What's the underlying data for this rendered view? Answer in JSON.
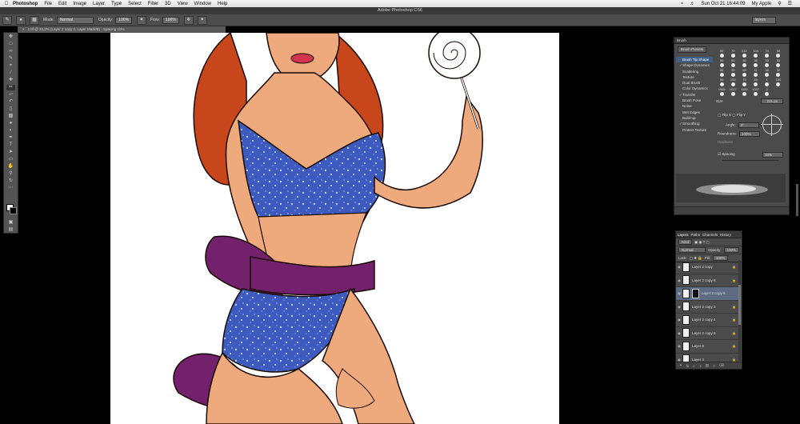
{
  "menubar": {
    "app": "Photoshop",
    "items": [
      "File",
      "Edit",
      "Image",
      "Layer",
      "Type",
      "Select",
      "Filter",
      "3D",
      "View",
      "Window",
      "Help"
    ],
    "clock": "Sun Oct 21  16:44:09",
    "user": "My Apple"
  },
  "window_title": "Adobe Photoshop CS6",
  "options": {
    "mode_label": "Mode:",
    "mode_value": "Normal",
    "opacity_label": "Opacity:",
    "opacity_value": "100%",
    "flow_label": "Flow:",
    "flow_value": "100%",
    "workspace": "layers"
  },
  "doc_tab": "1.tif @ 33.3% (Layer 2 copy 2, Layer Mask/8) - Spacing 10%",
  "brush_panel": {
    "title": "Brush",
    "presets_button": "Brush Presets",
    "settings": [
      {
        "label": "Brush Tip Shape",
        "checked": false,
        "active": true
      },
      {
        "label": "Shape Dynamics",
        "checked": true,
        "active": false
      },
      {
        "label": "Scattering",
        "checked": false,
        "active": false
      },
      {
        "label": "Texture",
        "checked": false,
        "active": false
      },
      {
        "label": "Dual Brush",
        "checked": false,
        "active": false
      },
      {
        "label": "Color Dynamics",
        "checked": false,
        "active": false
      },
      {
        "label": "Transfer",
        "checked": true,
        "active": false
      },
      {
        "label": "Brush Pose",
        "checked": false,
        "active": false
      },
      {
        "label": "Noise",
        "checked": false,
        "active": false
      },
      {
        "label": "Wet Edges",
        "checked": false,
        "active": false
      },
      {
        "label": "Build-up",
        "checked": false,
        "active": false
      },
      {
        "label": "Smoothing",
        "checked": true,
        "active": false
      },
      {
        "label": "Protect Texture",
        "checked": false,
        "active": false
      }
    ],
    "tips": [
      "55",
      "70",
      "112",
      "134",
      "74",
      "95",
      "95",
      "90",
      "36",
      "36",
      "33",
      "63",
      "66",
      "39",
      "63",
      "11",
      "48",
      "32",
      "55",
      "100",
      "75",
      "45",
      "1",
      "100",
      "1945",
      "1017",
      "1152",
      "1057",
      "2"
    ],
    "size_label": "Size",
    "size_value": "221 px",
    "flip_x": "Flip X",
    "flip_y": "Flip Y",
    "angle_label": "Angle:",
    "angle_value": "0°",
    "roundness_label": "Roundness:",
    "roundness_value": "100%",
    "hardness_label": "Hardness",
    "spacing_label": "Spacing",
    "spacing_value": "10%"
  },
  "layers_panel": {
    "tabs": [
      "Layers",
      "Paths",
      "Channels",
      "History"
    ],
    "kind_label": "Kind",
    "blend_mode": "Normal",
    "opacity_label": "Opacity:",
    "opacity_value": "100%",
    "lock_label": "Lock:",
    "fill_label": "Fill:",
    "fill_value": "100%",
    "layers": [
      {
        "name": "Layer 2 copy",
        "selected": false,
        "mask": false
      },
      {
        "name": "Layer 2 copy 8",
        "selected": false,
        "mask": false
      },
      {
        "name": "Layer 2 copy 6",
        "selected": true,
        "mask": true
      },
      {
        "name": "Layer 2 copy 2",
        "selected": false,
        "mask": false
      },
      {
        "name": "Layer 2 copy 4",
        "selected": false,
        "mask": false
      },
      {
        "name": "Layer 2 copy 5",
        "selected": false,
        "mask": false
      },
      {
        "name": "Layer 6",
        "selected": false,
        "mask": false
      },
      {
        "name": "Layer 4",
        "selected": false,
        "mask": false
      }
    ]
  },
  "colors": {
    "skin": "#eea97c",
    "hair": "#c8461c",
    "bikini": "#3d5bbf",
    "bow": "#74216d",
    "lips": "#d2344f"
  }
}
